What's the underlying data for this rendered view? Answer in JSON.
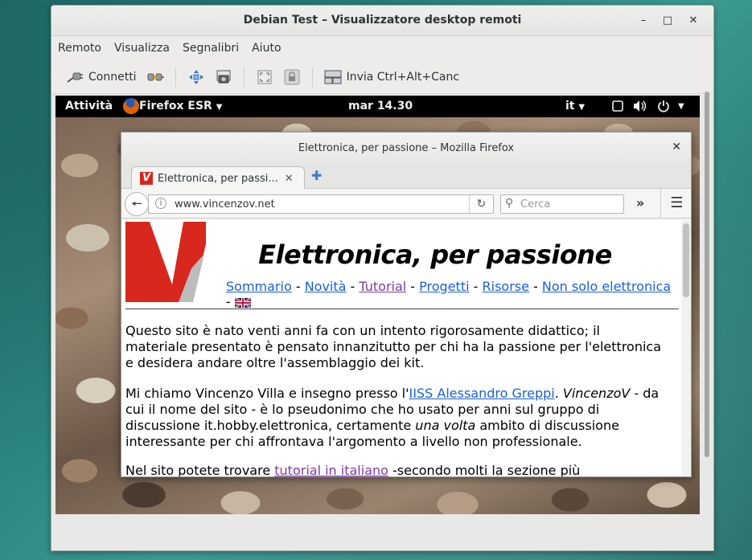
{
  "viewer": {
    "title": "Debian Test – Visualizzatore desktop remoti",
    "menu": [
      "Remoto",
      "Visualizza",
      "Segnalibri",
      "Aiuto"
    ],
    "toolbar": {
      "connect_label": "Connetti",
      "send_keys_label": "Invia Ctrl+Alt+Canc"
    }
  },
  "gnome": {
    "activities": "Attività",
    "app_menu": "Firefox ESR",
    "clock": "mar 14.30",
    "input_lang": "it"
  },
  "firefox": {
    "window_title": "Elettronica, per passione – Mozilla Firefox",
    "tab_label": "Elettronica, per passi...",
    "url": "www.vincenzov.net",
    "search_placeholder": "Cerca"
  },
  "page": {
    "title": "Elettronica, per passione",
    "nav": [
      {
        "label": "Sommario",
        "visited": false
      },
      {
        "label": "Novità",
        "visited": false
      },
      {
        "label": "Tutorial",
        "visited": true
      },
      {
        "label": "Progetti",
        "visited": false
      },
      {
        "label": "Risorse",
        "visited": false
      },
      {
        "label": "Non solo elettronica",
        "visited": false
      }
    ],
    "nav_separator": " - ",
    "para1": "Questo sito è nato venti anni fa con un intento rigorosamente didattico; il materiale presentato è pensato innanzitutto per chi ha la passione per l'elettronica e desidera andare oltre l'assemblaggio dei kit.",
    "para2_pre": "Mi chiamo Vincenzo Villa e insegno presso l'",
    "para2_link": "IISS Alessandro Greppi",
    "para2_mid": ". ",
    "para2_italic": "VincenzoV",
    "para2_post": " - da cui il nome del sito - è lo pseudonimo che ho usato per anni sul gruppo di discussione it.hobby.elettronica, certamente ",
    "para2_italic2": "una volta",
    "para2_end": " ambito di discussione interessante per chi affrontava l'argomento a livello non professionale.",
    "para3_pre": "Nel sito potete trovare ",
    "para3_link": "tutorial in italiano",
    "para3_post": " -secondo molti la sezione più interessante- ed"
  }
}
